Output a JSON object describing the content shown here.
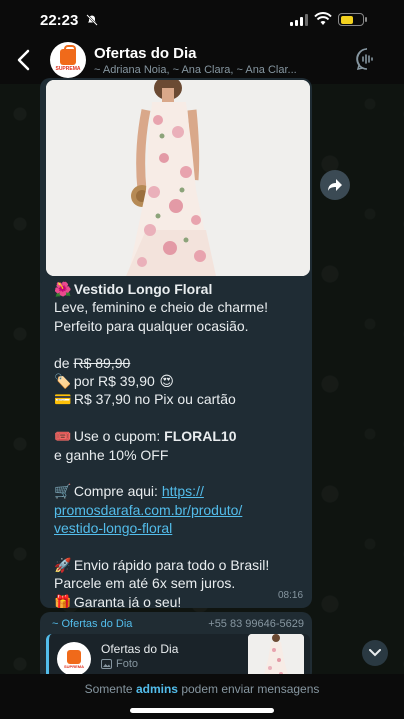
{
  "status_bar": {
    "time": "22:23"
  },
  "header": {
    "title": "Ofertas do Dia",
    "members": "~ Adriana Noia, ~ Ana Clara, ~ Ana Clar...",
    "avatar_brand": "SUPREMA"
  },
  "message": {
    "title_emoji": "🌺",
    "title": "Vestido Longo Floral",
    "desc1": "Leve, feminino e cheio de charme!",
    "desc2": "Perfeito para qualquer ocasião.",
    "de_label": "de",
    "old_price": "R$ 89,90",
    "por_emoji": "🏷️",
    "por_text": "por R$ 39,90",
    "por_after_emoji": "😍",
    "pix_emoji": "💳",
    "pix_text": "R$ 37,90 no Pix ou cartão",
    "coupon_emoji": "🎟️",
    "coupon_prefix": "Use o cupom:",
    "coupon_code": "FLORAL10",
    "coupon_suffix": "e ganhe 10% OFF",
    "buy_emoji": "🛒",
    "buy_text": "Compre aqui:",
    "link_part1": "https://",
    "link_part2": "promosdarafa.com.br/produto/",
    "link_part3": "vestido-longo-floral",
    "ship_emoji": "🚀",
    "ship_text": "Envio rápido para todo o Brasil!",
    "installments": "Parcele em até 6x sem juros.",
    "gift_emoji": "🎁",
    "guarantee": "Garanta já o seu!",
    "time": "08:16"
  },
  "reply_preview": {
    "sender": "~ Ofertas do Dia",
    "phone": "+55 83 99646-5629",
    "quoted_title": "Ofertas do Dia",
    "quoted_type": "Foto",
    "avatar_brand": "SUPREMA"
  },
  "footer": {
    "prefix": "Somente",
    "admins": "admins",
    "suffix": "podem enviar mensagens"
  },
  "colors": {
    "accent": "#53bdeb",
    "bubble": "#1f2c34",
    "brand_orange": "#f06a1a"
  }
}
